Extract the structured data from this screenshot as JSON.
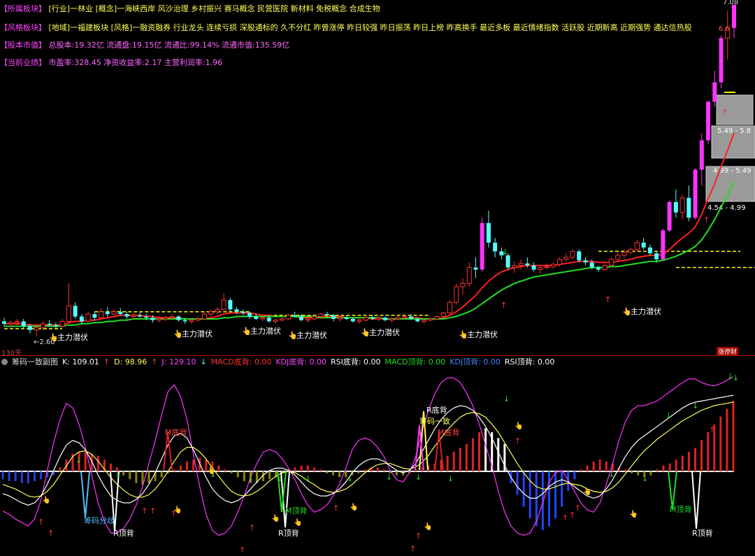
{
  "info": {
    "sector_tag": "【所属板块】",
    "sector_value": "[行业]一林业 [概念]一海峡西岸 风沙治理 乡村振兴 赛马概念 民营医院 新材料 免税概念 合成生物",
    "style_tag": "【风格板块】",
    "style_value": "[地域]一福建板块 [风格]一融资融券 行业龙头 连续亏损 深股通标的 久不分红 昨曾涨停 昨日较强 昨日振荡 昨日上榜 昨高换手 最近多板 最近情绪指数 活跃股 近期新高 近期强势 通达信热股",
    "equity_tag": "【股本市值】",
    "equity_value": "总股本:19.32亿 流通盘:19.15亿 流通比:99.14% 流通市值:135.59亿",
    "perf_tag": "【当前业绩】",
    "perf_value": "市盈率:328.45 净资收益率:2.17 主营利润率:1.96"
  },
  "labels": {
    "days": "130天",
    "corner_badge": "涨停财",
    "price_top": "7.08",
    "price_mid": "6.6",
    "low_label": "←2.60",
    "accum_label": "主力潜伏",
    "chip_ranges": [
      "5.49 - 5.8",
      "4.99 - 5.49",
      "4.54 - 4.99"
    ]
  },
  "sub_header": {
    "name": "筹码一致副图",
    "k": "K: 109.01",
    "d": "D: 98.96",
    "j": "J: 129.10",
    "macd_bottom": "MACD底背: 0.00",
    "kdj_bottom": "KDJ底背: 0.00",
    "rsi_bottom": "RSI底背: 0.00",
    "macd_top": "MACD顶背: 0.00",
    "kdj_top": "KDJ顶背: 0.00",
    "rsi_top": "RSI顶背: 0.00"
  },
  "sub_labels": {
    "m_bottom": "M底背",
    "r_bottom": "R底背",
    "chip_consensus": "筹码一致",
    "r_top": "R顶背",
    "m_top": "M顶背",
    "chip_split": "筹码分歧"
  },
  "colors": {
    "up": "#ff3333",
    "down": "#54ffff",
    "limit": "#ff33ff",
    "ma_red": "#ff2020",
    "ma_green": "#22dd22",
    "dash": "#ffff00",
    "k": "#ffffff",
    "d": "#ffff55",
    "j": "#ff33ff"
  },
  "chart_data": {
    "type": "candlestick",
    "candles": [
      [
        2.72,
        2.75,
        2.68,
        2.7
      ],
      [
        2.7,
        2.73,
        2.67,
        2.71
      ],
      [
        2.71,
        2.74,
        2.69,
        2.72
      ],
      [
        2.72,
        2.74,
        2.66,
        2.68
      ],
      [
        2.68,
        2.7,
        2.62,
        2.65
      ],
      [
        2.65,
        2.69,
        2.6,
        2.67
      ],
      [
        2.67,
        2.72,
        2.65,
        2.7
      ],
      [
        2.7,
        2.73,
        2.68,
        2.69
      ],
      [
        2.69,
        2.71,
        2.66,
        2.68
      ],
      [
        2.68,
        2.74,
        2.67,
        2.72
      ],
      [
        2.72,
        3.05,
        2.7,
        2.85
      ],
      [
        2.85,
        2.88,
        2.74,
        2.76
      ],
      [
        2.76,
        2.78,
        2.7,
        2.72
      ],
      [
        2.72,
        2.8,
        2.71,
        2.78
      ],
      [
        2.78,
        2.8,
        2.73,
        2.75
      ],
      [
        2.75,
        2.83,
        2.74,
        2.8
      ],
      [
        2.8,
        2.84,
        2.76,
        2.78
      ],
      [
        2.78,
        2.82,
        2.77,
        2.8
      ],
      [
        2.8,
        2.83,
        2.77,
        2.78
      ],
      [
        2.78,
        2.8,
        2.74,
        2.76
      ],
      [
        2.76,
        2.79,
        2.74,
        2.77
      ],
      [
        2.77,
        2.8,
        2.75,
        2.76
      ],
      [
        2.76,
        2.78,
        2.73,
        2.75
      ],
      [
        2.75,
        2.77,
        2.71,
        2.73
      ],
      [
        2.73,
        2.76,
        2.71,
        2.74
      ],
      [
        2.74,
        2.77,
        2.72,
        2.75
      ],
      [
        2.75,
        2.78,
        2.74,
        2.76
      ],
      [
        2.76,
        2.77,
        2.72,
        2.73
      ],
      [
        2.73,
        2.75,
        2.7,
        2.72
      ],
      [
        2.72,
        2.74,
        2.7,
        2.73
      ],
      [
        2.73,
        2.76,
        2.72,
        2.74
      ],
      [
        2.74,
        2.8,
        2.73,
        2.78
      ],
      [
        2.78,
        2.82,
        2.76,
        2.8
      ],
      [
        2.8,
        2.84,
        2.77,
        2.82
      ],
      [
        2.82,
        2.96,
        2.8,
        2.9
      ],
      [
        2.9,
        2.92,
        2.8,
        2.82
      ],
      [
        2.82,
        2.84,
        2.78,
        2.8
      ],
      [
        2.8,
        2.82,
        2.77,
        2.79
      ],
      [
        2.79,
        2.8,
        2.74,
        2.76
      ],
      [
        2.76,
        2.78,
        2.73,
        2.74
      ],
      [
        2.74,
        2.76,
        2.72,
        2.75
      ],
      [
        2.75,
        2.77,
        2.71,
        2.72
      ],
      [
        2.72,
        2.74,
        2.7,
        2.73
      ],
      [
        2.73,
        2.75,
        2.72,
        2.74
      ],
      [
        2.74,
        2.78,
        2.73,
        2.77
      ],
      [
        2.77,
        2.8,
        2.75,
        2.76
      ],
      [
        2.76,
        2.78,
        2.72,
        2.73
      ],
      [
        2.73,
        2.75,
        2.71,
        2.74
      ],
      [
        2.74,
        2.77,
        2.73,
        2.76
      ],
      [
        2.76,
        2.79,
        2.74,
        2.78
      ],
      [
        2.78,
        2.8,
        2.75,
        2.77
      ],
      [
        2.77,
        2.78,
        2.72,
        2.74
      ],
      [
        2.74,
        2.76,
        2.72,
        2.75
      ],
      [
        2.75,
        2.77,
        2.73,
        2.74
      ],
      [
        2.74,
        2.75,
        2.71,
        2.72
      ],
      [
        2.72,
        2.74,
        2.7,
        2.73
      ],
      [
        2.73,
        2.76,
        2.72,
        2.75
      ],
      [
        2.75,
        2.77,
        2.73,
        2.74
      ],
      [
        2.74,
        2.76,
        2.72,
        2.75
      ],
      [
        2.75,
        2.76,
        2.72,
        2.73
      ],
      [
        2.73,
        2.75,
        2.71,
        2.74
      ],
      [
        2.74,
        2.76,
        2.73,
        2.75
      ],
      [
        2.75,
        2.77,
        2.74,
        2.76
      ],
      [
        2.76,
        2.78,
        2.73,
        2.74
      ],
      [
        2.74,
        2.75,
        2.71,
        2.72
      ],
      [
        2.72,
        2.74,
        2.7,
        2.73
      ],
      [
        2.73,
        2.75,
        2.72,
        2.74
      ],
      [
        2.74,
        2.77,
        2.73,
        2.76
      ],
      [
        2.76,
        2.8,
        2.75,
        2.79
      ],
      [
        2.79,
        2.9,
        2.78,
        2.88
      ],
      [
        2.88,
        3.05,
        2.86,
        3.02
      ],
      [
        3.02,
        3.1,
        2.95,
        3.05
      ],
      [
        3.05,
        3.25,
        3.02,
        3.2
      ],
      [
        3.2,
        3.3,
        3.1,
        3.18
      ],
      [
        3.18,
        3.72,
        3.16,
        3.66
      ],
      [
        3.66,
        3.8,
        3.4,
        3.45
      ],
      [
        3.45,
        3.5,
        3.3,
        3.36
      ],
      [
        3.36,
        3.4,
        3.28,
        3.32
      ],
      [
        3.32,
        3.34,
        3.18,
        3.2
      ],
      [
        3.2,
        3.26,
        3.15,
        3.22
      ],
      [
        3.22,
        3.28,
        3.18,
        3.24
      ],
      [
        3.24,
        3.3,
        3.2,
        3.22
      ],
      [
        3.22,
        3.25,
        3.16,
        3.18
      ],
      [
        3.18,
        3.22,
        3.14,
        3.2
      ],
      [
        3.2,
        3.24,
        3.18,
        3.21
      ],
      [
        3.21,
        3.25,
        3.19,
        3.23
      ],
      [
        3.23,
        3.3,
        3.21,
        3.28
      ],
      [
        3.28,
        3.34,
        3.26,
        3.3
      ],
      [
        3.3,
        3.38,
        3.28,
        3.36
      ],
      [
        3.36,
        3.38,
        3.25,
        3.27
      ],
      [
        3.27,
        3.3,
        3.22,
        3.25
      ],
      [
        3.25,
        3.28,
        3.18,
        3.2
      ],
      [
        3.2,
        3.22,
        3.16,
        3.18
      ],
      [
        3.18,
        3.24,
        3.17,
        3.22
      ],
      [
        3.22,
        3.3,
        3.21,
        3.28
      ],
      [
        3.28,
        3.35,
        3.26,
        3.32
      ],
      [
        3.32,
        3.38,
        3.3,
        3.35
      ],
      [
        3.35,
        3.4,
        3.33,
        3.38
      ],
      [
        3.38,
        3.48,
        3.36,
        3.45
      ],
      [
        3.45,
        3.5,
        3.38,
        3.4
      ],
      [
        3.4,
        3.43,
        3.32,
        3.34
      ],
      [
        3.34,
        3.36,
        3.25,
        3.28
      ],
      [
        3.28,
        3.6,
        3.27,
        3.58
      ],
      [
        3.58,
        3.92,
        3.56,
        3.9
      ],
      [
        3.9,
        4.05,
        3.72,
        3.78
      ],
      [
        3.78,
        3.98,
        3.7,
        3.95
      ],
      [
        3.95,
        4.1,
        3.68,
        3.72
      ],
      [
        3.72,
        4.32,
        3.7,
        4.3
      ],
      [
        4.3,
        4.8,
        4.1,
        4.7
      ],
      [
        4.7,
        5.3,
        4.65,
        5.28
      ],
      [
        5.28,
        5.8,
        5.2,
        5.6
      ],
      [
        5.6,
        6.45,
        5.5,
        6.4
      ],
      [
        6.4,
        6.95,
        6.0,
        6.6
      ],
      [
        6.6,
        7.08,
        6.4,
        7.08
      ]
    ],
    "ma_red": [
      2.7,
      2.7,
      2.7,
      2.7,
      2.69,
      2.69,
      2.69,
      2.69,
      2.69,
      2.69,
      2.71,
      2.72,
      2.72,
      2.73,
      2.73,
      2.74,
      2.75,
      2.76,
      2.77,
      2.77,
      2.77,
      2.77,
      2.76,
      2.76,
      2.75,
      2.75,
      2.75,
      2.75,
      2.74,
      2.74,
      2.74,
      2.74,
      2.75,
      2.76,
      2.78,
      2.79,
      2.79,
      2.79,
      2.79,
      2.78,
      2.77,
      2.77,
      2.76,
      2.76,
      2.76,
      2.76,
      2.75,
      2.75,
      2.75,
      2.75,
      2.76,
      2.76,
      2.76,
      2.75,
      2.75,
      2.75,
      2.75,
      2.74,
      2.74,
      2.74,
      2.74,
      2.74,
      2.74,
      2.75,
      2.75,
      2.74,
      2.74,
      2.74,
      2.75,
      2.77,
      2.8,
      2.84,
      2.89,
      2.94,
      3.01,
      3.07,
      3.12,
      3.16,
      3.18,
      3.2,
      3.21,
      3.22,
      3.22,
      3.22,
      3.22,
      3.22,
      3.23,
      3.24,
      3.25,
      3.26,
      3.26,
      3.26,
      3.25,
      3.25,
      3.25,
      3.26,
      3.27,
      3.28,
      3.3,
      3.31,
      3.32,
      3.32,
      3.33,
      3.38,
      3.44,
      3.5,
      3.55,
      3.62,
      3.76,
      3.94,
      4.12,
      4.34,
      4.56,
      4.8
    ],
    "ma_green": [
      2.68,
      2.68,
      2.68,
      2.68,
      2.68,
      2.68,
      2.68,
      2.68,
      2.68,
      2.68,
      2.69,
      2.69,
      2.7,
      2.7,
      2.71,
      2.71,
      2.72,
      2.72,
      2.73,
      2.73,
      2.74,
      2.74,
      2.74,
      2.74,
      2.74,
      2.74,
      2.74,
      2.74,
      2.74,
      2.74,
      2.74,
      2.74,
      2.74,
      2.74,
      2.75,
      2.75,
      2.76,
      2.76,
      2.76,
      2.76,
      2.76,
      2.76,
      2.76,
      2.76,
      2.76,
      2.76,
      2.76,
      2.76,
      2.76,
      2.75,
      2.75,
      2.75,
      2.75,
      2.75,
      2.75,
      2.75,
      2.75,
      2.75,
      2.75,
      2.74,
      2.74,
      2.74,
      2.74,
      2.74,
      2.74,
      2.74,
      2.74,
      2.74,
      2.74,
      2.75,
      2.76,
      2.78,
      2.8,
      2.83,
      2.87,
      2.91,
      2.95,
      2.99,
      3.02,
      3.05,
      3.07,
      3.09,
      3.11,
      3.12,
      3.13,
      3.14,
      3.15,
      3.16,
      3.17,
      3.18,
      3.19,
      3.2,
      3.2,
      3.2,
      3.21,
      3.21,
      3.22,
      3.23,
      3.24,
      3.25,
      3.26,
      3.26,
      3.27,
      3.29,
      3.31,
      3.34,
      3.37,
      3.41,
      3.48,
      3.58,
      3.7,
      3.84,
      3.98,
      4.14
    ]
  },
  "macd_bars": [
    -4,
    -5,
    -5,
    -6,
    -6,
    -5,
    -4,
    -3,
    -2,
    2,
    6,
    9,
    10,
    10,
    9,
    8,
    6,
    4,
    2,
    -2,
    -4,
    -6,
    -7,
    -6,
    -5,
    -3,
    -1,
    1,
    3,
    5,
    6,
    7,
    6,
    5,
    3,
    1,
    -1,
    -3,
    -5,
    -6,
    -6,
    -5,
    -4,
    -3,
    -1,
    1,
    2,
    3,
    3,
    2,
    1,
    -1,
    -2,
    -3,
    -3,
    -2,
    -1,
    1,
    2,
    2,
    1,
    -1,
    -2,
    -2,
    -1,
    1,
    2,
    3,
    4,
    6,
    8,
    10,
    12,
    14,
    17,
    20,
    22,
    20,
    17,
    14,
    -6,
    -12,
    -18,
    -24,
    -28,
    -30,
    -28,
    -24,
    -18,
    -10,
    -4,
    1,
    3,
    5,
    6,
    5,
    4,
    2,
    1,
    -1,
    -2,
    -3,
    -2,
    1,
    3,
    4,
    6,
    8,
    10,
    12,
    16,
    20,
    24,
    28,
    32,
    36
  ],
  "kdj_k": [
    20,
    18,
    15,
    12,
    10,
    12,
    18,
    28,
    40,
    52,
    62,
    66,
    64,
    58,
    48,
    36,
    26,
    18,
    14,
    12,
    12,
    15,
    20,
    28,
    38,
    50,
    62,
    70,
    72,
    68,
    58,
    46,
    34,
    24,
    18,
    14,
    12,
    14,
    18,
    24,
    30,
    36,
    40,
    42,
    42,
    40,
    36,
    30,
    24,
    20,
    18,
    18,
    20,
    24,
    30,
    38,
    44,
    48,
    50,
    50,
    48,
    44,
    40,
    38,
    40,
    46,
    56,
    66,
    76,
    84,
    90,
    94,
    96,
    95,
    92,
    86,
    78,
    68,
    56,
    44,
    34,
    26,
    20,
    16,
    16,
    20,
    26,
    30,
    32,
    30,
    26,
    22,
    18,
    16,
    18,
    24,
    32,
    42,
    52,
    60,
    66,
    70,
    74,
    78,
    82,
    86,
    90,
    94,
    97,
    99,
    100,
    101,
    102,
    103,
    104,
    105
  ],
  "kdj_d": [
    28,
    26,
    24,
    21,
    18,
    17,
    18,
    22,
    28,
    36,
    44,
    52,
    56,
    57,
    54,
    48,
    41,
    34,
    28,
    23,
    19,
    17,
    17,
    19,
    24,
    31,
    39,
    48,
    56,
    60,
    60,
    56,
    50,
    42,
    35,
    28,
    22,
    19,
    18,
    19,
    22,
    26,
    31,
    35,
    38,
    39,
    38,
    35,
    31,
    28,
    24,
    22,
    21,
    22,
    24,
    28,
    33,
    38,
    42,
    45,
    46,
    46,
    44,
    42,
    41,
    43,
    47,
    53,
    61,
    68,
    75,
    81,
    86,
    89,
    90,
    89,
    86,
    80,
    73,
    64,
    55,
    46,
    38,
    31,
    26,
    24,
    24,
    26,
    28,
    29,
    28,
    27,
    24,
    22,
    21,
    22,
    25,
    30,
    37,
    44,
    51,
    57,
    62,
    67,
    71,
    75,
    79,
    83,
    86,
    89,
    92,
    94,
    96,
    97,
    98,
    99
  ],
  "kdj_j": [
    5,
    2,
    -2,
    -5,
    -8,
    -2,
    14,
    40,
    64,
    84,
    98,
    94,
    80,
    60,
    36,
    12,
    -4,
    -14,
    -14,
    -10,
    -2,
    10,
    26,
    46,
    66,
    88,
    108,
    114,
    104,
    84,
    54,
    26,
    2,
    -12,
    -16,
    -14,
    -8,
    4,
    18,
    34,
    46,
    56,
    58,
    56,
    50,
    42,
    32,
    20,
    10,
    4,
    6,
    10,
    18,
    28,
    42,
    58,
    66,
    68,
    66,
    60,
    52,
    40,
    32,
    30,
    38,
    52,
    74,
    92,
    106,
    116,
    120,
    120,
    116,
    107,
    96,
    80,
    62,
    44,
    22,
    4,
    -8,
    -14,
    -16,
    -14,
    -4,
    12,
    30,
    38,
    40,
    32,
    22,
    12,
    6,
    4,
    12,
    28,
    46,
    66,
    82,
    92,
    96,
    96,
    98,
    100,
    104,
    108,
    112,
    116,
    119,
    119,
    116,
    114,
    113,
    115,
    118,
    121
  ]
}
